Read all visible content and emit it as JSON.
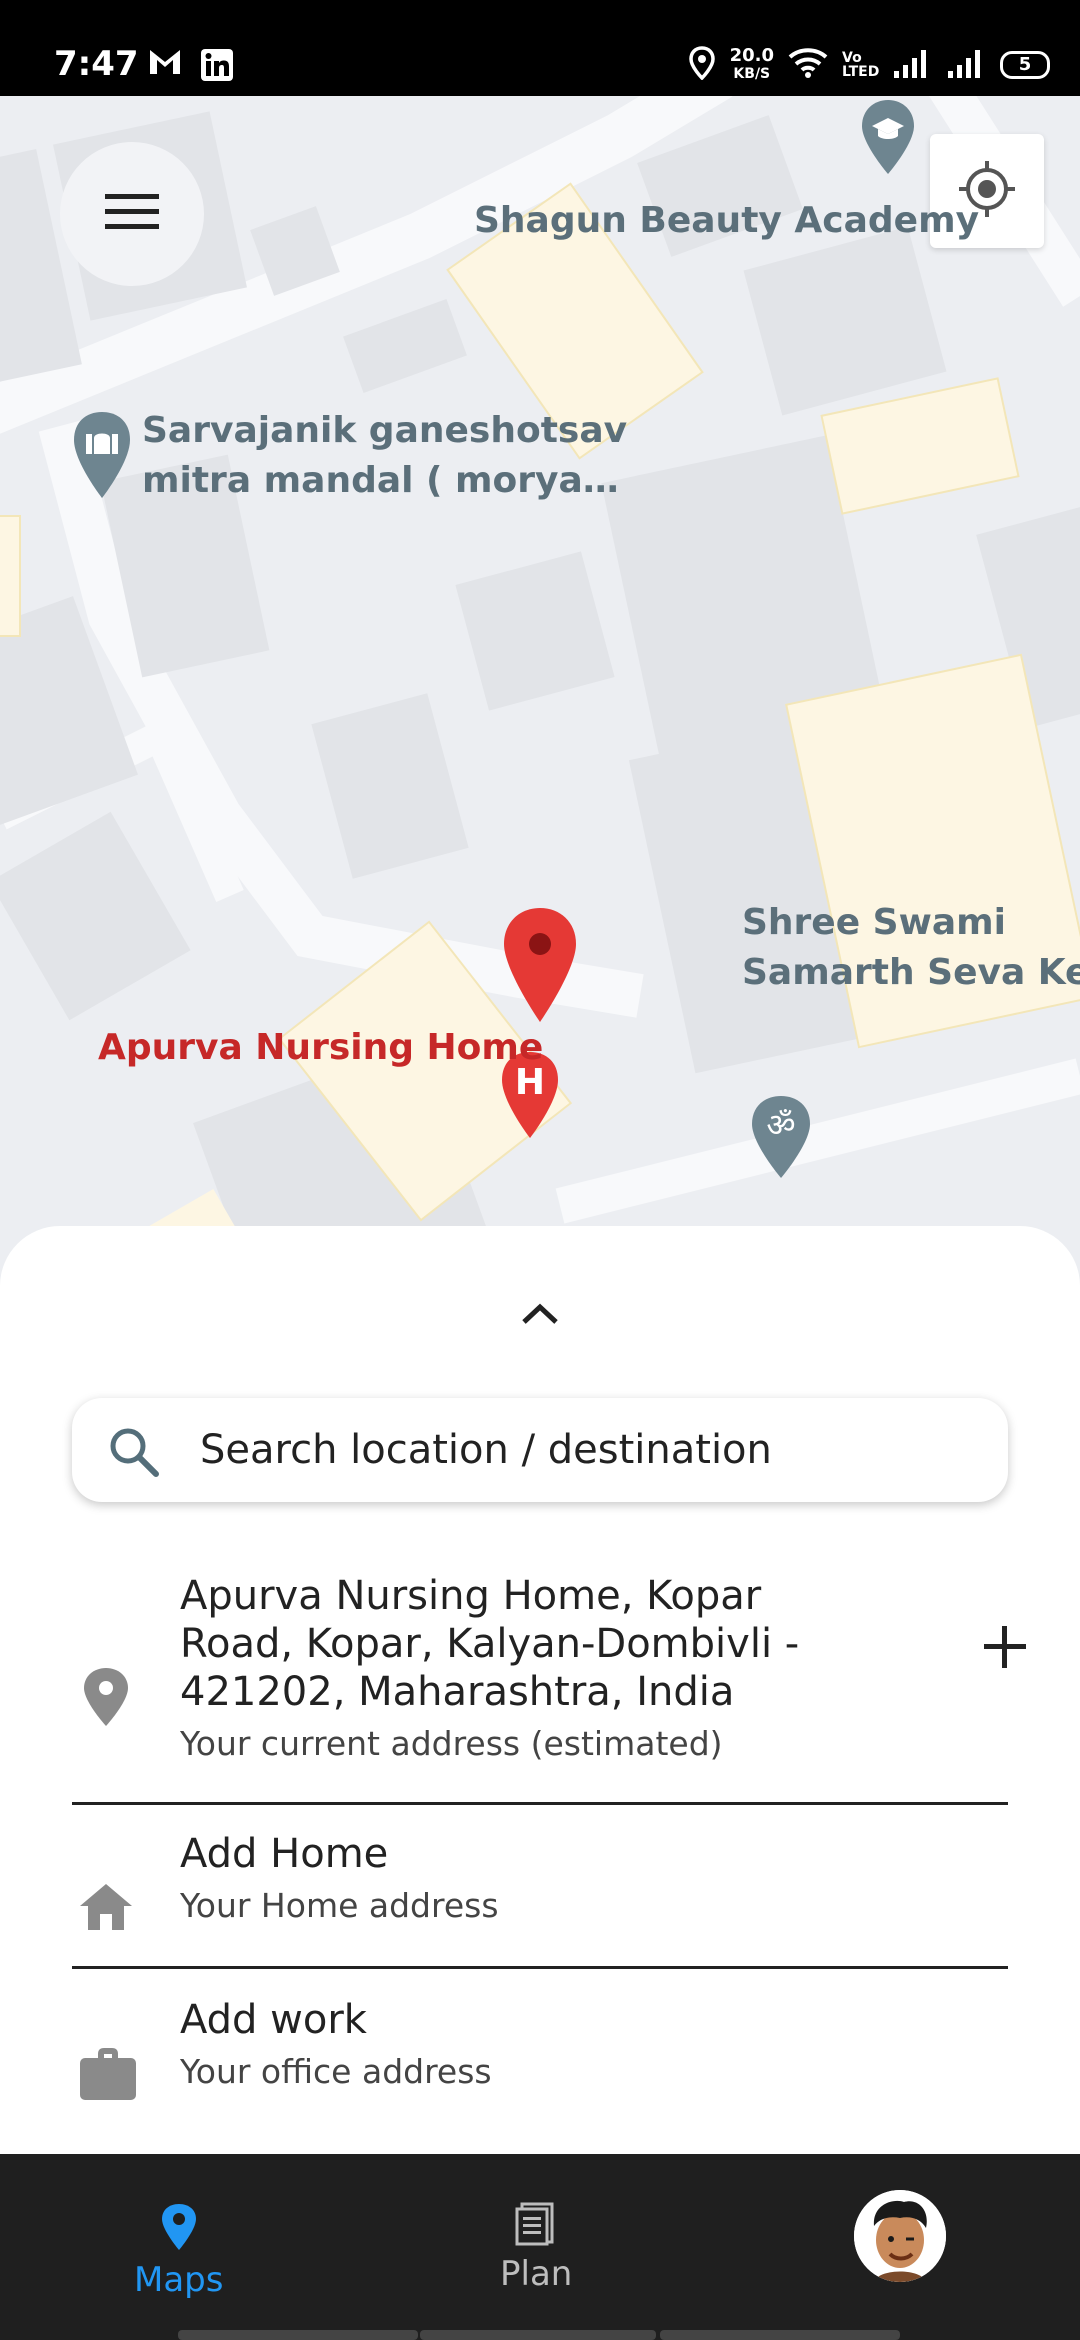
{
  "status_bar": {
    "time": "7:47",
    "speed_value": "20.0",
    "speed_unit": "KB/S",
    "volte": "Vo LTED",
    "battery": "5",
    "icons": [
      "gmail-icon",
      "linkedin-icon",
      "location-icon",
      "wifi-icon",
      "signal-icon",
      "signal-icon",
      "battery-icon"
    ]
  },
  "map": {
    "labels": {
      "shagun": "Shagun Beauty Academy",
      "ganesh_line1": "Sarvajanik ganeshotsav",
      "ganesh_line2": "mitra mandal ( morya…",
      "swami_line1": "Shree Swami",
      "swami_line2": "Samarth Seva Kend",
      "apurva": "Apurva Nursing Home"
    },
    "colors": {
      "selected_pin": "#e53935",
      "hospital_pin": "#e53935",
      "poi_pin": "#6e8590"
    }
  },
  "sheet": {
    "search_placeholder": "Search location / destination",
    "current": {
      "address_line1": "Apurva Nursing Home, Kopar",
      "address_line2": "Road, Kopar, Kalyan-Dombivli -",
      "address_line3": "421202, Maharashtra, India",
      "subtitle": "Your current address (estimated)"
    },
    "home": {
      "title": "Add Home",
      "subtitle": "Your Home address"
    },
    "work": {
      "title": "Add work",
      "subtitle": "Your office address"
    }
  },
  "bottom_nav": {
    "maps_label": "Maps",
    "plan_label": "Plan",
    "active_color": "#2196f3",
    "inactive_color": "#bdbdbd"
  }
}
